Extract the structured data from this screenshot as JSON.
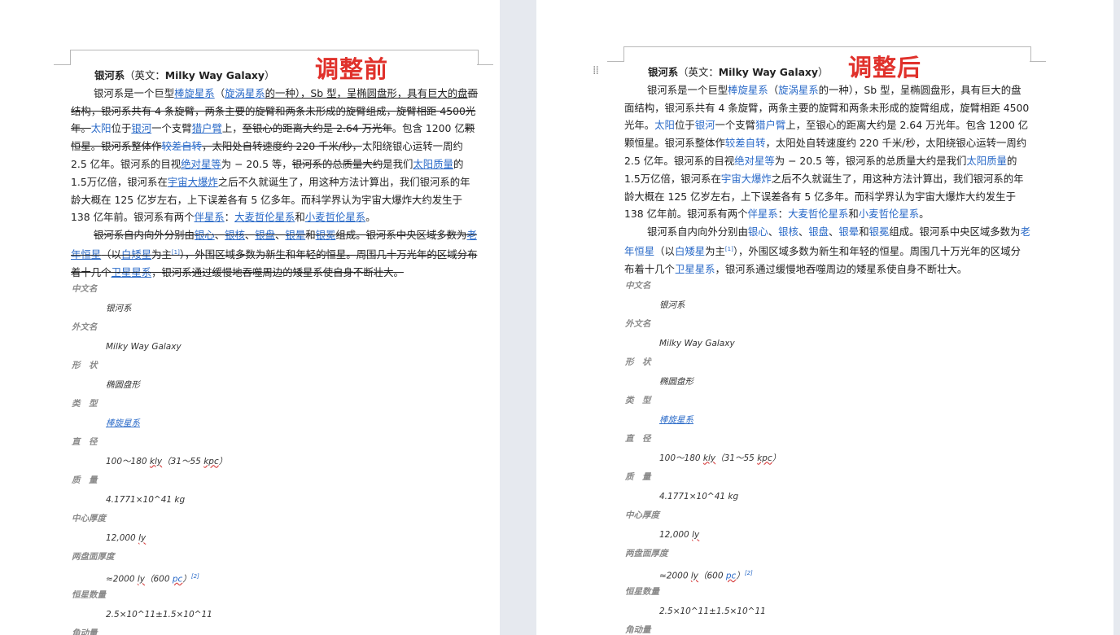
{
  "left": {
    "stamp": "调整前",
    "title": {
      "bold": "银河系",
      "paren": "（英文：",
      "en": "Milky Way Galaxy",
      "close": "）"
    },
    "p1": {
      "a": "银河系是一个巨型",
      "l1": "棒旋星系",
      "b": "（",
      "l2": "旋涡星系",
      "c": "的一种），Sb 型，呈椭圆盘形，具有巨大的盘",
      "d": "面结构，银河系共有 4 条旋臂，两条主要的旋臂和两条未形成的旋臂组成，旋臂相距 4500",
      "e": "光年。",
      "l3": "太阳",
      "f": "位于",
      "l4": "银河",
      "g": "一个支臂",
      "l5": "猎户臂",
      "h": "上，",
      "i": "至银心的距离大约是 2.64 万光年",
      "j": "。包含 1200 亿",
      "k": "颗恒星。银河系整体作",
      "l6": "较差自转",
      "m": "，太阳处自转速度约 220 千米/秒，",
      "n": "太阳绕银心运转一周约",
      "o": "2.5 亿年。银河系的目视",
      "l7": "绝对星等",
      "p": "为 − 20.5 等，",
      "q": "银河系的总质量大约",
      "r": "是我们",
      "l8": "太阳质量",
      "s": "的 1.5",
      "t": "万亿倍，银河系在",
      "l9": "宇宙大爆炸",
      "u": "之后不久就诞生了，用这种方法计算出，我们银河系的年龄大",
      "v": "概在 125 亿岁左右，上下误差各有 5 亿多年。而科学界认为宇宙大爆炸大约发生于 138 亿",
      "w": "年前。银河系有两个",
      "l10": "伴星系",
      "x": "：",
      "l11": "大麦哲伦星系",
      "y": "和",
      "l12": "小麦哲伦星系",
      "z": "。"
    },
    "p2": {
      "a": "银河系自内向外分别由",
      "l1": "银心",
      "s1": "、",
      "l2": "银核",
      "s2": "、",
      "l3": "银盘",
      "s3": "、",
      "l4": "银晕",
      "s4": "和",
      "l5": "银冕",
      "b": "组成。银河系中央区域多数为",
      "l6": "老年恒星",
      "c": "（以",
      "l7": "白矮星",
      "d": "为主",
      "sup": "[1]",
      "e": "），外围区域多数为新生和年轻的恒星。周围几十万光年的区",
      "f": "域分布着十几个",
      "l8": "卫星星系",
      "g": "，银河系通过缓慢地吞噬周边的矮星系使自身不断壮大。"
    }
  },
  "right": {
    "stamp": "调整后",
    "title": {
      "bold": "银河系",
      "paren": "（英文：",
      "en": "Milky Way Galaxy",
      "close": "）"
    },
    "p1": {
      "a": "银河系是一个巨型",
      "l1": "棒旋星系",
      "b": "（",
      "l2": "旋涡星系",
      "c": "的一种），Sb 型，呈椭圆盘形，具有巨大的盘",
      "d": "面结构，银河系共有 4 条旋臂，两条主要的旋臂和两条未形成的旋臂组成，旋臂相距 4500",
      "e": "光年。",
      "l3": "太阳",
      "f": "位于",
      "l4": "银河",
      "g": "一个支臂",
      "l5": "猎户臂",
      "h": "上，至银心的距离大约是 2.64 万光年。包含 1200 亿",
      "i": "颗恒星。银河系整体作",
      "l6": "较差自转",
      "j": "，太阳处自转速度约 220 千米/秒，太阳绕银心运转一周约",
      "k": "2.5 亿年。银河系的目视",
      "l7": "绝对星等",
      "m": "为 − 20.5 等，银河系的总质量大约是我们",
      "l8": "太阳质量",
      "n": "的 1.5",
      "o": "万亿倍，银河系在",
      "l9": "宇宙大爆炸",
      "p": "之后不久就诞生了，用这种方法计算出，我们银河系的年龄大",
      "q": "概在 125 亿岁左右，上下误差各有 5 亿多年。而科学界认为宇宙大爆炸大约发生于 138 亿",
      "r": "年前。银河系有两个",
      "l10": "伴星系",
      "s": "：",
      "l11": "大麦哲伦星系",
      "t": "和",
      "l12": "小麦哲伦星系",
      "u": "。"
    },
    "p2": {
      "a": "银河系自内向外分别由",
      "l1": "银心",
      "s1": "、",
      "l2": "银核",
      "s2": "、",
      "l3": "银盘",
      "s3": "、",
      "l4": "银晕",
      "s4": "和",
      "l5": "银冕",
      "b": "组成。银河系中央区域多数为",
      "l6": "老年恒星",
      "c": "（以",
      "l7": "白矮星",
      "d": "为主",
      "sup": "[1]",
      "e": "），外围区域多数为新生和年轻的恒星。周围几十万光年的区",
      "f": "域分布着十几个",
      "l8": "卫星星系",
      "g": "，银河系通过缓慢地吞噬周边的矮星系使自身不断壮大。"
    }
  },
  "info": {
    "name_cn_label": "中文名",
    "name_cn": "银河系",
    "name_en_label": "外文名",
    "name_en": "Milky Way Galaxy",
    "shape_label": "形　状",
    "shape": "椭圆盘形",
    "type_label": "类　型",
    "type": "棒旋星系",
    "diameter_label": "直　径",
    "diameter_a": "100～180 ",
    "diameter_kly": "kly",
    "diameter_b": "（31～55 ",
    "diameter_kpc": "kpc",
    "diameter_c": "）",
    "mass_label": "质　量",
    "mass": "4.1771×10^41 kg",
    "center_thick_label": "中心厚度",
    "center_thick_a": "12,000 ",
    "center_thick_ly": "ly",
    "disk_thick_label": "两盘面厚度",
    "disk_thick_a": "≈2000 ",
    "disk_thick_ly": "ly",
    "disk_thick_b": "（600 ",
    "disk_thick_pc": "pc",
    "disk_thick_c": "）",
    "disk_thick_sup": "[2]",
    "stars_label": "恒星数量",
    "stars": "2.5×10^11±1.5×10^11",
    "angmom_label": "角动量"
  }
}
